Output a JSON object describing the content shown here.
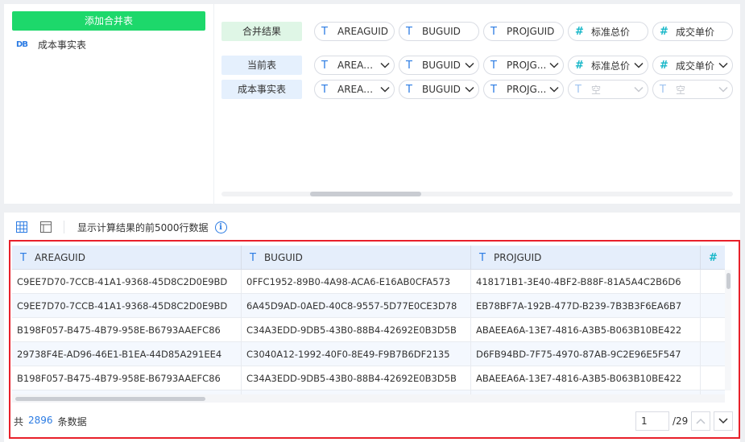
{
  "left_panel": {
    "add_button": "添加合并表",
    "table_item": "成本事实表"
  },
  "merge": {
    "rows": [
      {
        "label": "合并结果",
        "fields": [
          {
            "type": "T",
            "name": "AREAGUID"
          },
          {
            "type": "T",
            "name": "BUGUID"
          },
          {
            "type": "T",
            "name": "PROJGUID"
          },
          {
            "type": "#",
            "name": "标准总价"
          },
          {
            "type": "#",
            "name": "成交单价"
          }
        ]
      },
      {
        "label": "当前表",
        "fields": [
          {
            "type": "T",
            "name": "AREAG..."
          },
          {
            "type": "T",
            "name": "BUGUID"
          },
          {
            "type": "T",
            "name": "PROJG..."
          },
          {
            "type": "#",
            "name": "标准总价"
          },
          {
            "type": "#",
            "name": "成交单价"
          }
        ]
      },
      {
        "label": "成本事实表",
        "fields": [
          {
            "type": "T",
            "name": "AREAG..."
          },
          {
            "type": "T",
            "name": "BUGUID"
          },
          {
            "type": "T",
            "name": "PROJG..."
          },
          {
            "type": "T",
            "name": "空",
            "empty": true
          },
          {
            "type": "T",
            "name": "空",
            "empty": true
          }
        ]
      }
    ]
  },
  "toolbar": {
    "note": "显示计算结果的前5000行数据",
    "info_icon": "i"
  },
  "table": {
    "columns": [
      {
        "type": "T",
        "name": "AREAGUID"
      },
      {
        "type": "T",
        "name": "BUGUID"
      },
      {
        "type": "T",
        "name": "PROJGUID"
      },
      {
        "type": "#",
        "name": ""
      }
    ],
    "rows": [
      [
        "C9EE7D70-7CCB-41A1-9368-45D8C2D0E9BD",
        "0FFC1952-89B0-4A98-ACA6-E16AB0CFA573",
        "418171B1-3E40-4BF2-B88F-81A5A4C2B6D6"
      ],
      [
        "C9EE7D70-7CCB-41A1-9368-45D8C2D0E9BD",
        "6A45D9AD-0AED-40C8-9557-5D77E0CE3D78",
        "EB78BF7A-192B-477D-B239-7B3B3F6EA6B7"
      ],
      [
        "B198F057-B475-4B79-958E-B6793AAEFC86",
        "C34A3EDD-9DB5-43B0-88B4-42692E0B3D5B",
        "ABAEEA6A-13E7-4816-A3B5-B063B10BE422"
      ],
      [
        "29738F4E-AD96-46E1-B1EA-44D85A291EE4",
        "C3040A12-1992-40F0-8E49-F9B7B6DF2135",
        "D6FB94BD-7F75-4970-87AB-9C2E96E5F547"
      ],
      [
        "B198F057-B475-4B79-958E-B6793AAEFC86",
        "C34A3EDD-9DB5-43B0-88B4-42692E0B3D5B",
        "ABAEEA6A-13E7-4816-A3B5-B063B10BE422"
      ]
    ]
  },
  "footer": {
    "prefix": "共",
    "count": "2896",
    "suffix": "条数据",
    "page": "1",
    "total_pages": "/29"
  },
  "colors": {
    "accent_green": "#1dd86b",
    "accent_blue": "#2b7be3",
    "highlight_red": "#e8202a"
  }
}
